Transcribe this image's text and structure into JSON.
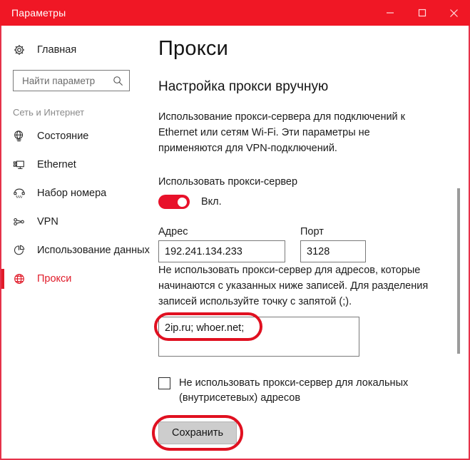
{
  "window": {
    "title": "Параметры",
    "accent_red": "#f01725",
    "controls": [
      {
        "name": "minimize",
        "glyph": "minimize-icon"
      },
      {
        "name": "maximize",
        "glyph": "maximize-icon"
      },
      {
        "name": "close",
        "glyph": "close-icon"
      }
    ]
  },
  "sidebar": {
    "home": {
      "label": "Главная",
      "icon": "gear-icon"
    },
    "search": {
      "placeholder": "Найти параметр",
      "value": "",
      "icon": "search-icon"
    },
    "section_label": "Сеть и Интернет",
    "items": [
      {
        "label": "Состояние",
        "icon": "globe-network-icon",
        "active": false
      },
      {
        "label": "Ethernet",
        "icon": "monitor-icon",
        "active": false
      },
      {
        "label": "Набор номера",
        "icon": "phone-icon",
        "active": false
      },
      {
        "label": "VPN",
        "icon": "vpn-nodes-icon",
        "active": false
      },
      {
        "label": "Использование данных",
        "icon": "pie-chart-icon",
        "active": false
      },
      {
        "label": "Прокси",
        "icon": "globe-icon",
        "active": true
      }
    ]
  },
  "main": {
    "page_title": "Прокси",
    "section_title": "Настройка прокси вручную",
    "description": "Использование прокси-сервера для подключений к Ethernet или сетям Wi-Fi. Эти параметры не применяются для VPN-подключений.",
    "toggle": {
      "label": "Использовать прокси-сервер",
      "state_text": "Вкл.",
      "on": true,
      "color": "#e8112a"
    },
    "address": {
      "label": "Адрес",
      "value": "192.241.134.233"
    },
    "port": {
      "label": "Порт",
      "value": "3128"
    },
    "exclusion": {
      "description": "Не использовать прокси-сервер для адресов, которые начинаются с указанных ниже записей. Для разделения записей используйте точку с запятой (;).",
      "value": "2ip.ru; whoer.net;"
    },
    "local_checkbox": {
      "label": "Не использовать прокси-сервер для локальных (внутрисетевых) адресов",
      "checked": false
    },
    "save_button": "Сохранить"
  },
  "annotations": {
    "color": "#e01020",
    "targets": [
      "exclusion-field-text",
      "save-button"
    ]
  }
}
